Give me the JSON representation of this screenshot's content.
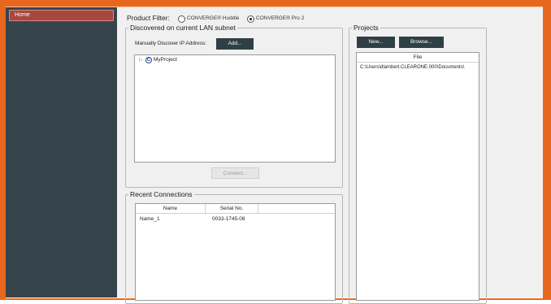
{
  "sidebar": {
    "items": [
      {
        "label": "Home"
      }
    ]
  },
  "filter": {
    "label": "Product Filter:",
    "options": [
      {
        "label": "CONVERGE® Huddle",
        "selected": false
      },
      {
        "label": "CONVERGE® Pro 2",
        "selected": true
      }
    ]
  },
  "discover": {
    "title": "Discovered on current LAN subnet",
    "manual_label": "Manually Discover IP Address:",
    "add_label": "Add...",
    "tree": [
      {
        "label": "MyProject",
        "icon": "clearone-project-icon"
      }
    ],
    "connect_label": "Connect..."
  },
  "recent": {
    "title": "Recent Connections",
    "columns": [
      "Name",
      "Serial No."
    ],
    "rows": [
      {
        "name": "Name_1",
        "serial": "0033-1745-08"
      }
    ]
  },
  "projects": {
    "title": "Projects",
    "new_label": "New...",
    "browse_label": "Browse...",
    "columns": [
      "File"
    ],
    "rows": [
      {
        "file": "C:\\Users\\dlambert.CLEARONE.000\\Documents\\"
      }
    ]
  }
}
